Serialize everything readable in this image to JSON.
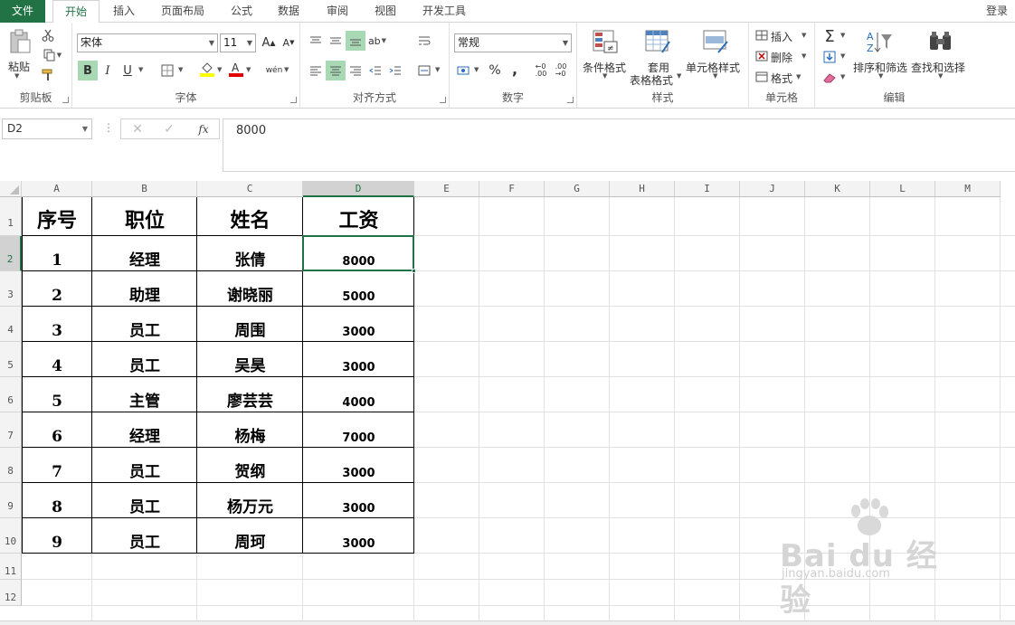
{
  "tabs": {
    "file": "文件",
    "items": [
      "开始",
      "插入",
      "页面布局",
      "公式",
      "数据",
      "审阅",
      "视图",
      "开发工具"
    ],
    "login": "登录"
  },
  "ribbon": {
    "clipboard": {
      "paste": "粘贴",
      "label": "剪贴板"
    },
    "font": {
      "name": "宋体",
      "size": "11",
      "bold": "B",
      "italic": "I",
      "underline": "U",
      "label": "字体"
    },
    "alignment": {
      "label": "对齐方式"
    },
    "number": {
      "format": "常规",
      "percent": "%",
      "comma": ",",
      "label": "数字"
    },
    "styles": {
      "conditional": "条件格式",
      "table_line1": "套用",
      "table_line2": "表格格式",
      "cell_styles": "单元格样式",
      "label": "样式"
    },
    "cells": {
      "insert": "插入",
      "delete": "删除",
      "format": "格式",
      "label": "单元格"
    },
    "editing": {
      "sort": "排序和筛选",
      "find": "查找和选择",
      "label": "编辑"
    }
  },
  "formula_bar": {
    "name_box": "D2",
    "fx": "fx",
    "value": "8000"
  },
  "columns": [
    "A",
    "B",
    "C",
    "D",
    "E",
    "F",
    "G",
    "H",
    "I",
    "J",
    "K",
    "L",
    "M"
  ],
  "rows": [
    "1",
    "2",
    "3",
    "4",
    "5",
    "6",
    "7",
    "8",
    "9",
    "10",
    "11",
    "12"
  ],
  "table": {
    "headers": [
      "序号",
      "职位",
      "姓名",
      "工资"
    ],
    "rows": [
      [
        "1",
        "经理",
        "张倩",
        "8000"
      ],
      [
        "2",
        "助理",
        "谢晓丽",
        "5000"
      ],
      [
        "3",
        "员工",
        "周围",
        "3000"
      ],
      [
        "4",
        "员工",
        "吴昊",
        "3000"
      ],
      [
        "5",
        "主管",
        "廖芸芸",
        "4000"
      ],
      [
        "6",
        "经理",
        "杨梅",
        "7000"
      ],
      [
        "7",
        "员工",
        "贺纲",
        "3000"
      ],
      [
        "8",
        "员工",
        "杨万元",
        "3000"
      ],
      [
        "9",
        "员工",
        "周珂",
        "3000"
      ]
    ]
  },
  "watermark": {
    "brand": "Bai du 经验",
    "url": "jingyan.baidu.com"
  },
  "colors": {
    "accent": "#217346",
    "selection_fill": "#a9d8b5"
  }
}
